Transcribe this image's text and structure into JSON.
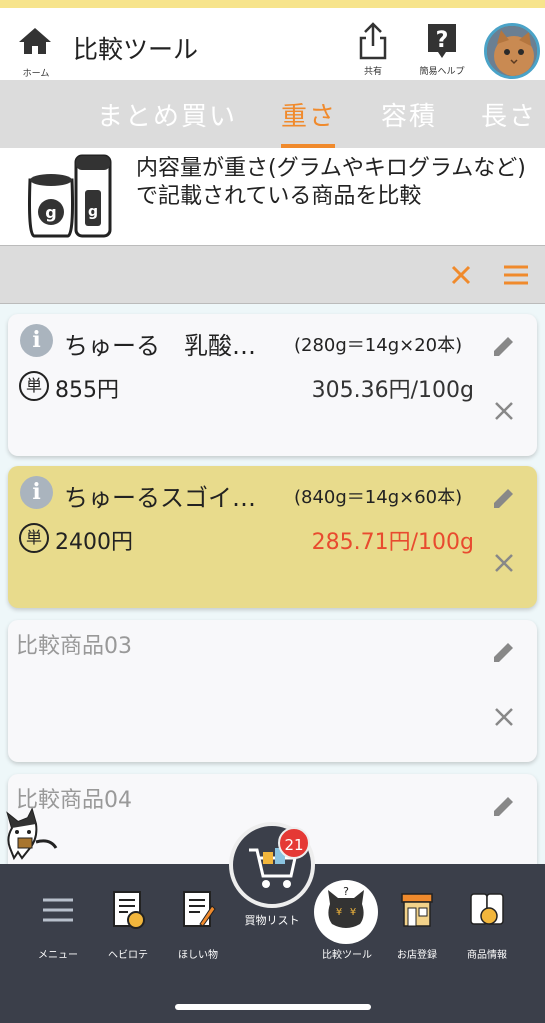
{
  "header": {
    "home_label": "ホーム",
    "title": "比較ツール",
    "share_label": "共有",
    "help_label": "簡易ヘルプ"
  },
  "tabs": [
    {
      "label": "まとめ買い",
      "active": false
    },
    {
      "label": "重さ",
      "active": true
    },
    {
      "label": "容積",
      "active": false
    },
    {
      "label": "長さ",
      "active": false
    }
  ],
  "description": "内容量が重さ(グラムやキログラムなど)で記載されている商品を比較",
  "unit_badge": "単",
  "items": [
    {
      "name": "ちゅーる　乳酸…",
      "quantity": "(280g＝14g×20本)",
      "price": "855円",
      "unit_price": "305.36円/100g",
      "best": false
    },
    {
      "name": "ちゅーるスゴイ…",
      "quantity": "(840g＝14g×60本)",
      "price": "2400円",
      "unit_price": "285.71円/100g",
      "best": true
    },
    {
      "placeholder": "比較商品03"
    },
    {
      "placeholder": "比較商品04"
    }
  ],
  "bottom_nav": {
    "menu": "メニュー",
    "hebirote": "ヘビロテ",
    "wishlist": "ほしい物",
    "cart_label": "買物リスト",
    "cart_count": "21",
    "compare": "比較ツール",
    "store": "お店登録",
    "product_info": "商品情報"
  },
  "colors": {
    "accent": "#f08a2c",
    "best_highlight": "#e8db8c",
    "best_price": "#e84b2f",
    "nav_bg": "#3b3f4a"
  }
}
